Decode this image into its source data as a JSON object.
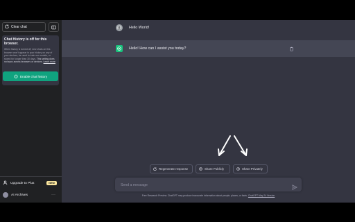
{
  "sidebar": {
    "clear_chat_label": "Clear chat",
    "history_title": "Chat History is off for this browser.",
    "history_text_1": "When history is turned off, new chats on this browser won't appear in your history on any of your devices, be used to train our models, or stored for longer than 30 days.",
    "history_text_bold": "This setting does not sync across browsers or devices.",
    "learn_more": "Learn more",
    "enable_label": "Enable chat history",
    "upgrade_label": "Upgrade to Plus",
    "new_badge": "NEW",
    "account_label": "AI Archives"
  },
  "messages": {
    "user_text": "Hello World!",
    "bot_text": "Hello! How can I assist you today?"
  },
  "actions": {
    "regenerate": "Regenerate response",
    "share_public": "Share Publicly",
    "share_private": "Share Privately"
  },
  "composer": {
    "placeholder": "Send a message"
  },
  "footer": {
    "text": "Free Research Preview. ChatGPT may produce inaccurate information about people, places, or facts.",
    "link": "ChatGPT May 24 Version"
  },
  "colors": {
    "sidebar_bg": "#202123",
    "main_bg": "#343541",
    "bot_row_bg": "#444654",
    "accent": "#10a37f"
  },
  "icons": [
    "plus-icon",
    "sidebar-toggle-icon",
    "power-icon",
    "user-icon",
    "bot-logo-icon",
    "clipboard-icon",
    "regenerate-icon",
    "share-icon",
    "send-icon",
    "more-icon"
  ]
}
